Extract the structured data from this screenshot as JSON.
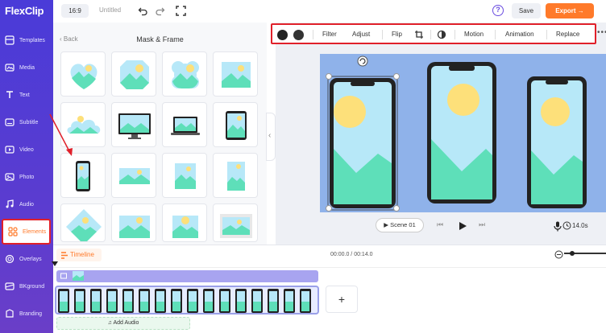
{
  "app": {
    "logo": "FlexClip",
    "ratio": "16:9",
    "project_title": "Untitled",
    "save_label": "Save",
    "export_label": "Export →",
    "help_label": "?"
  },
  "sidebar": {
    "items": [
      {
        "label": "Templates",
        "icon": "templates-icon"
      },
      {
        "label": "Media",
        "icon": "media-icon"
      },
      {
        "label": "Text",
        "icon": "text-icon"
      },
      {
        "label": "Subtitle",
        "icon": "subtitle-icon"
      },
      {
        "label": "Video",
        "icon": "video-icon"
      },
      {
        "label": "Photo",
        "icon": "photo-icon"
      },
      {
        "label": "Audio",
        "icon": "audio-icon"
      },
      {
        "label": "Elements",
        "icon": "elements-icon",
        "active": true
      },
      {
        "label": "Overlays",
        "icon": "overlays-icon"
      },
      {
        "label": "BKground",
        "icon": "background-icon"
      },
      {
        "label": "Branding",
        "icon": "branding-icon"
      }
    ]
  },
  "panel": {
    "back_label": "Back",
    "title": "Mask & Frame"
  },
  "toolbar": {
    "filter": "Filter",
    "adjust": "Adjust",
    "flip": "Flip",
    "motion": "Motion",
    "animation": "Animation",
    "replace": "Replace"
  },
  "player": {
    "scene_label": "Scene 01",
    "duration": "14.0s"
  },
  "timeline": {
    "label": "Timeline",
    "time": "00:00.0 / 00:14.0",
    "add_audio": "Add Audio",
    "add_label": "+"
  },
  "colors": {
    "accent": "#5a3cd0",
    "export": "#ff7a2a",
    "highlight": "#e0202a",
    "sky": "#b7e8f8",
    "mountain": "#5edfb9",
    "sun": "#fde07a"
  }
}
